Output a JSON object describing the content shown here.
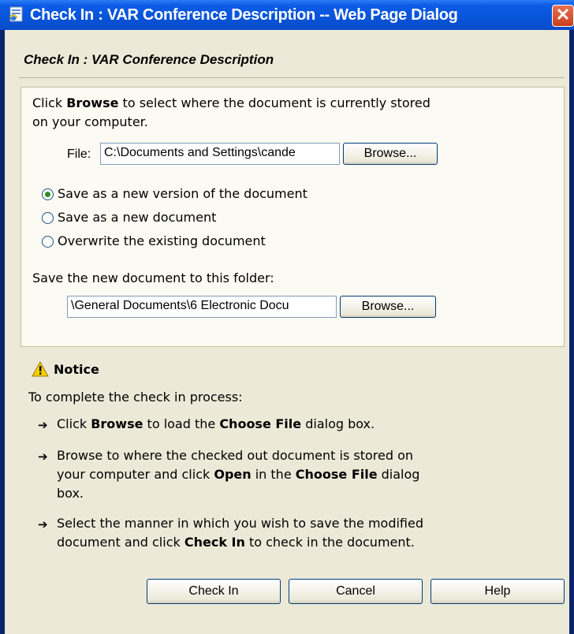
{
  "window": {
    "title": "Check In : VAR Conference Description -- Web Page Dialog",
    "close_glyph": "✕"
  },
  "dialog": {
    "heading": "Check In : VAR Conference Description",
    "instruction_prefix": "Click ",
    "instruction_bold": "Browse",
    "instruction_suffix": " to select where the document is currently stored",
    "instruction_line2": "on your computer.",
    "file_label": "File:",
    "file_value": "C:\\Documents and Settings\\cande",
    "browse_label": "Browse...",
    "options": [
      {
        "label": "Save as a new version of the document",
        "checked": true
      },
      {
        "label": "Save as a new document",
        "checked": false
      },
      {
        "label": "Overwrite the existing document",
        "checked": false
      }
    ],
    "folder_label": "Save the new document to this folder:",
    "folder_value": "\\General Documents\\6 Electronic Docu",
    "folder_browse_label": "Browse..."
  },
  "notice": {
    "title": "Notice",
    "intro": "To complete the check in process:",
    "steps": [
      {
        "parts": [
          "Click ",
          "Browse",
          " to load the ",
          "Choose File",
          " dialog box."
        ]
      },
      {
        "line1": "Browse to where the checked out document is stored on",
        "line2_parts": [
          "your computer and click ",
          "Open",
          " in the ",
          "Choose File",
          " dialog"
        ],
        "line3": "box."
      },
      {
        "line1": "Select the manner in which you wish to save the modified",
        "line2_parts": [
          "document and click ",
          "Check In",
          " to check in the document."
        ]
      }
    ],
    "arrow_glyph": "➔"
  },
  "buttons": {
    "check_in": "Check In",
    "cancel": "Cancel",
    "help": "Help"
  }
}
